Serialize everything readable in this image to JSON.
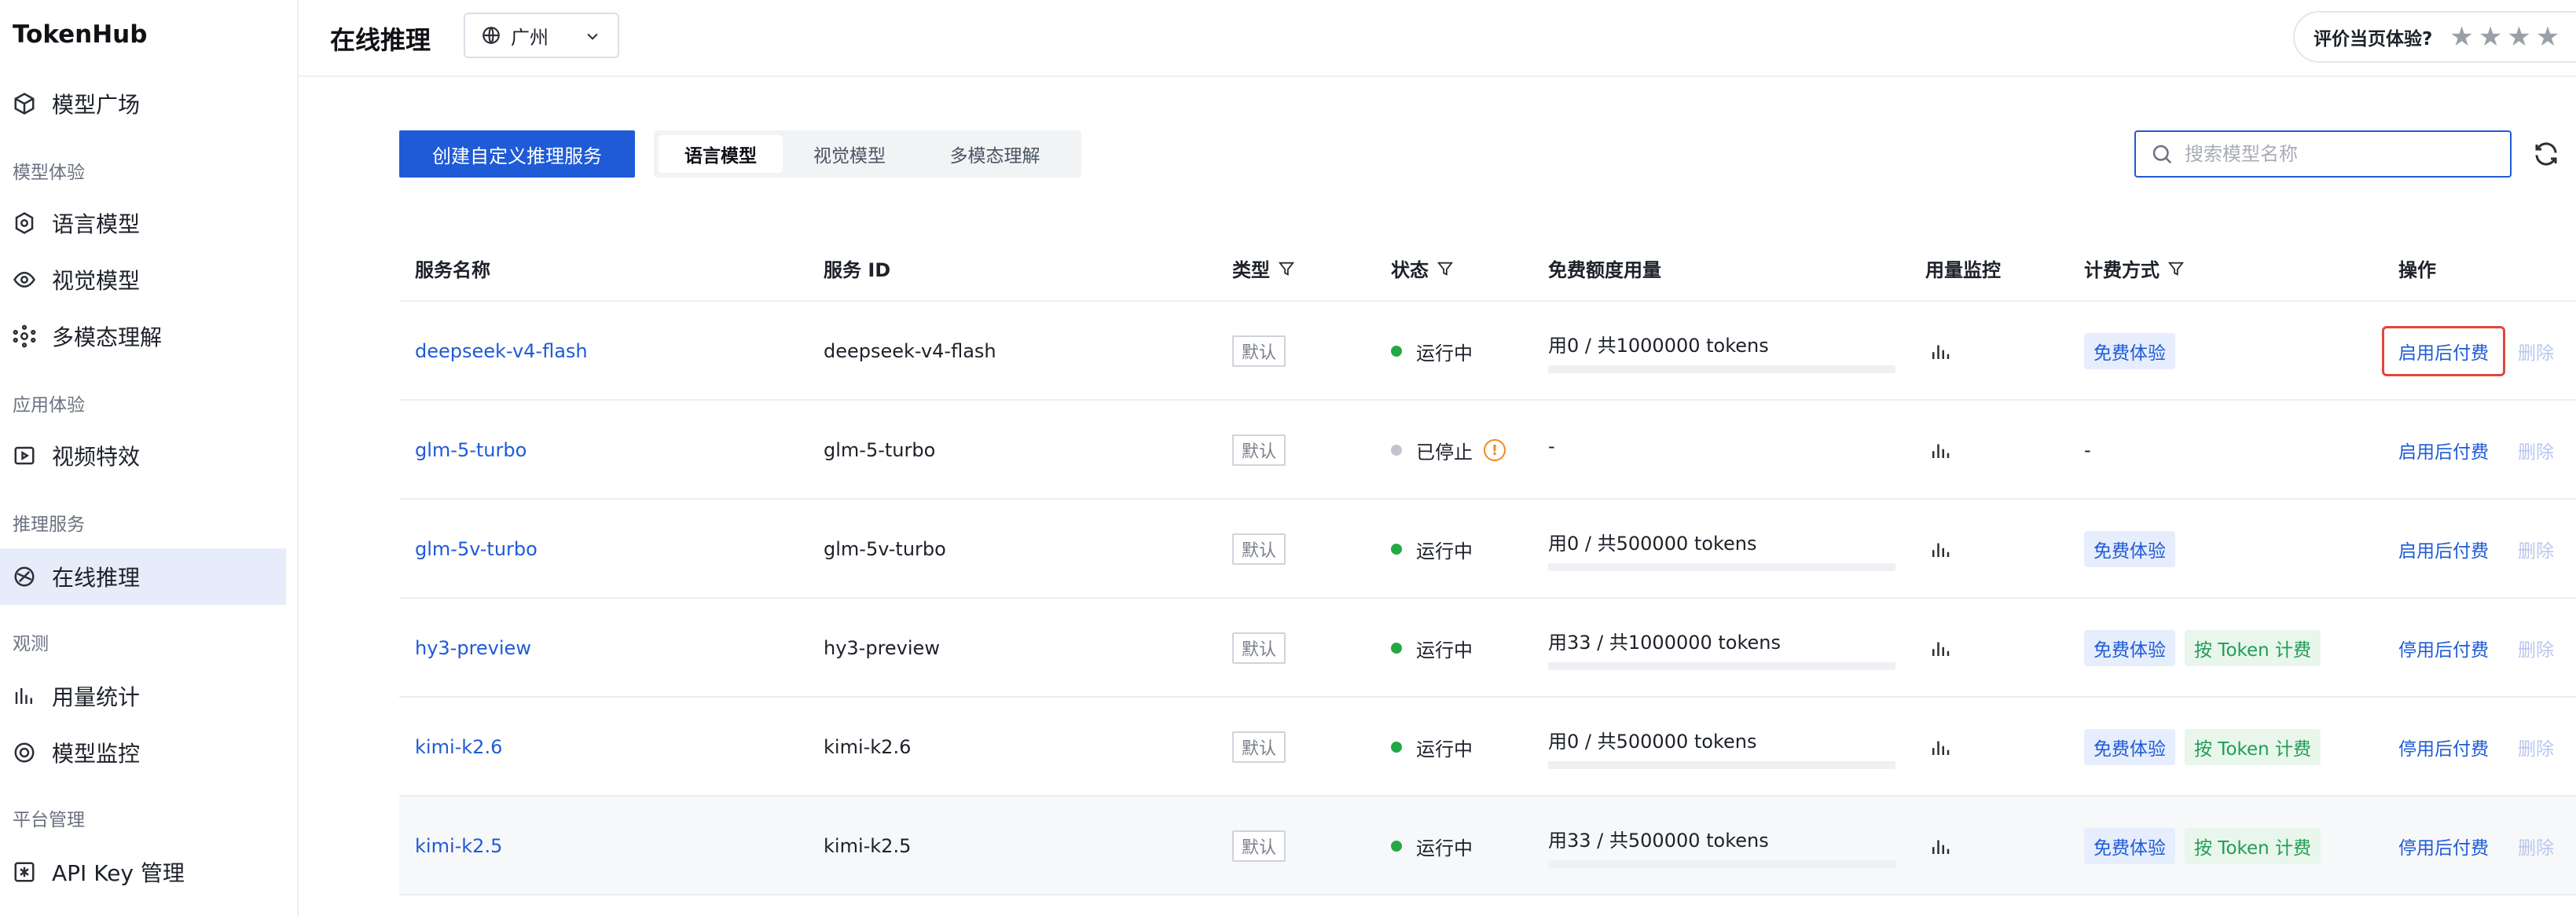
{
  "brand": "TokenHub",
  "sidebar": {
    "items": [
      {
        "label": "模型广场",
        "icon": "cube-icon"
      },
      {
        "group": "模型体验"
      },
      {
        "label": "语言模型",
        "icon": "language-model-icon"
      },
      {
        "label": "视觉模型",
        "icon": "eye-icon"
      },
      {
        "label": "多模态理解",
        "icon": "multimodal-icon"
      },
      {
        "group": "应用体验"
      },
      {
        "label": "视频特效",
        "icon": "video-effect-icon"
      },
      {
        "group": "推理服务"
      },
      {
        "label": "在线推理",
        "icon": "online-inference-icon",
        "active": true
      },
      {
        "group": "观测"
      },
      {
        "label": "用量统计",
        "icon": "bar-chart-icon"
      },
      {
        "label": "模型监控",
        "icon": "monitor-icon"
      },
      {
        "group": "平台管理"
      },
      {
        "label": "API Key 管理",
        "icon": "key-icon"
      }
    ]
  },
  "header": {
    "title": "在线推理",
    "region": "广州",
    "rating_label": "评价当页体验?",
    "stars": "★★★★"
  },
  "toolbar": {
    "create_label": "创建自定义推理服务",
    "tabs": [
      {
        "label": "语言模型",
        "active": true
      },
      {
        "label": "视觉模型",
        "active": false
      },
      {
        "label": "多模态理解",
        "active": false
      }
    ],
    "search_placeholder": "搜索模型名称"
  },
  "table": {
    "columns": {
      "name": "服务名称",
      "id": "服务 ID",
      "type": "类型",
      "status": "状态",
      "quota": "免费额度用量",
      "monitor": "用量监控",
      "billing": "计费方式",
      "ops": "操作"
    },
    "rows": [
      {
        "name": "deepseek-v4-flash",
        "id": "deepseek-v4-flash",
        "type": "默认",
        "status": "运行中",
        "running": true,
        "quota": "用0 / 共1000000 tokens",
        "usage": 0,
        "billing_free": "免费体验",
        "billing_token": "",
        "billing_none": "",
        "op": "启用后付费",
        "boxed": true,
        "del": "删除"
      },
      {
        "name": "glm-5-turbo",
        "id": "glm-5-turbo",
        "type": "默认",
        "status": "已停止",
        "running": false,
        "quota": "-",
        "usage": null,
        "billing_free": "",
        "billing_token": "",
        "billing_none": "-",
        "op": "启用后付费",
        "boxed": false,
        "del": "删除"
      },
      {
        "name": "glm-5v-turbo",
        "id": "glm-5v-turbo",
        "type": "默认",
        "status": "运行中",
        "running": true,
        "quota": "用0 / 共500000 tokens",
        "usage": 0,
        "billing_free": "免费体验",
        "billing_token": "",
        "billing_none": "",
        "op": "启用后付费",
        "boxed": false,
        "del": "删除"
      },
      {
        "name": "hy3-preview",
        "id": "hy3-preview",
        "type": "默认",
        "status": "运行中",
        "running": true,
        "quota": "用33 / 共1000000 tokens",
        "usage": 3.3e-05,
        "billing_free": "免费体验",
        "billing_token": "按 Token 计费",
        "billing_none": "",
        "op": "停用后付费",
        "boxed": false,
        "del": "删除"
      },
      {
        "name": "kimi-k2.6",
        "id": "kimi-k2.6",
        "type": "默认",
        "status": "运行中",
        "running": true,
        "quota": "用0 / 共500000 tokens",
        "usage": 0,
        "billing_free": "免费体验",
        "billing_token": "按 Token 计费",
        "billing_none": "",
        "op": "停用后付费",
        "boxed": false,
        "del": "删除"
      },
      {
        "name": "kimi-k2.5",
        "id": "kimi-k2.5",
        "type": "默认",
        "status": "运行中",
        "running": true,
        "quota": "用33 / 共500000 tokens",
        "usage": 6.6e-05,
        "billing_free": "免费体验",
        "billing_token": "按 Token 计费",
        "billing_none": "",
        "op": "停用后付费",
        "boxed": false,
        "del": "删除"
      }
    ]
  },
  "colors": {
    "primary": "#1f5bd6",
    "running": "#23a845",
    "stopped": "#c0c4cc",
    "highlight_box": "#e0483d"
  }
}
